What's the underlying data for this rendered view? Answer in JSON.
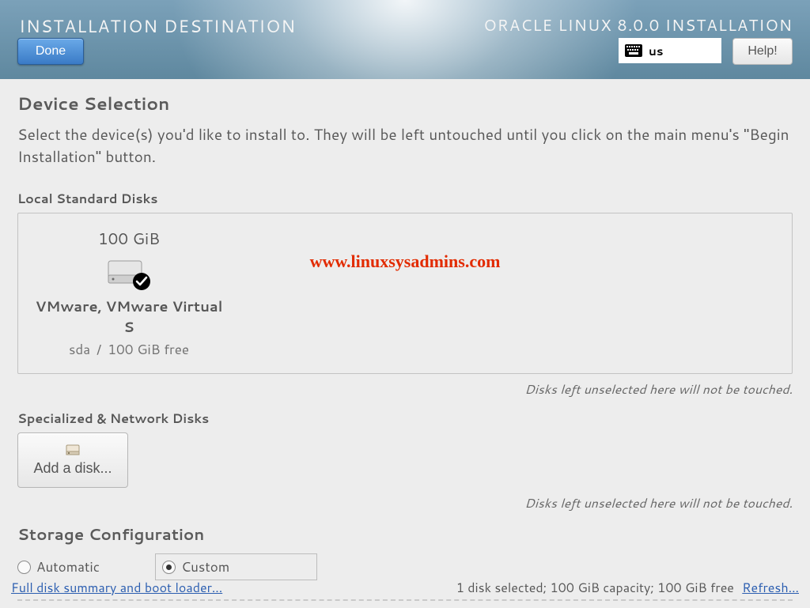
{
  "header": {
    "title": "INSTALLATION DESTINATION",
    "distro": "ORACLE LINUX 8.0.0 INSTALLATION",
    "done_label": "Done",
    "help_label": "Help!",
    "keyboard_layout": "us"
  },
  "device_selection": {
    "heading": "Device Selection",
    "description": "Select the device(s) you'd like to install to.  They will be left untouched until you click on the main menu's \"Begin Installation\" button."
  },
  "local_disks": {
    "heading": "Local Standard Disks",
    "hint": "Disks left unselected here will not be touched.",
    "disks": [
      {
        "size": "100 GiB",
        "name": "VMware, VMware Virtual S",
        "dev": "sda",
        "free": "100 GiB free",
        "selected": true
      }
    ]
  },
  "special_disks": {
    "heading": "Specialized & Network Disks",
    "add_label": "Add a disk...",
    "hint": "Disks left unselected here will not be touched."
  },
  "storage_config": {
    "heading": "Storage Configuration",
    "automatic_label": "Automatic",
    "custom_label": "Custom",
    "selected": "custom"
  },
  "footer": {
    "summary_link": "Full disk summary and boot loader...",
    "status": "1 disk selected; 100 GiB capacity; 100 GiB free",
    "refresh_label": "Refresh..."
  },
  "watermark": "www.linuxsysadmins.com"
}
